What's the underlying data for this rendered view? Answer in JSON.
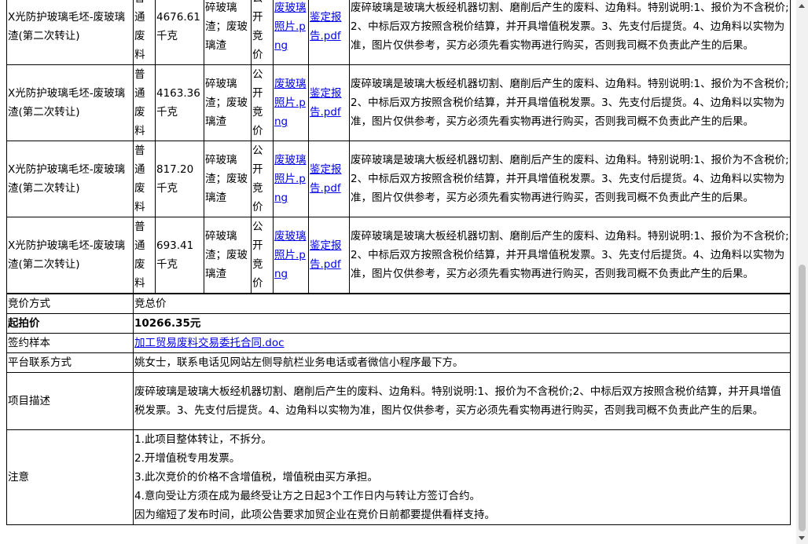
{
  "lots": [
    {
      "name": "X光防护玻璃毛坯-废玻璃渣(第二次转让)",
      "type": "普通废料",
      "weight": "4676.61千克",
      "category": "碎玻璃渣；废玻璃渣",
      "method": "公开竞价",
      "photo_link": "废玻璃照片.png",
      "report_link": "鉴定报告.pdf",
      "description": "废碎玻璃是玻璃大板经机器切割、磨削后产生的废料、边角料。特别说明:1、报价为不含税价;2、中标后双方按照含税价结算，并开具增值税发票。3、先支付后提货。4、边角料以实物为准，图片仅供参考，买方必须先看实物再进行购买，否则我司概不负责此产生的后果。"
    },
    {
      "name": "X光防护玻璃毛坯-废玻璃渣(第二次转让)",
      "type": "普通废料",
      "weight": "4163.36千克",
      "category": "碎玻璃渣；废玻璃渣",
      "method": "公开竞价",
      "photo_link": "废玻璃照片.png",
      "report_link": "鉴定报告.pdf",
      "description": "废碎玻璃是玻璃大板经机器切割、磨削后产生的废料、边角料。特别说明:1、报价为不含税价;2、中标后双方按照含税价结算，并开具增值税发票。3、先支付后提货。4、边角料以实物为准，图片仅供参考，买方必须先看实物再进行购买，否则我司概不负责此产生的后果。"
    },
    {
      "name": "X光防护玻璃毛坯-废玻璃渣(第二次转让)",
      "type": "普通废料",
      "weight": "817.20千克",
      "category": "碎玻璃渣；废玻璃渣",
      "method": "公开竞价",
      "photo_link": "废玻璃照片.png",
      "report_link": "鉴定报告.pdf",
      "description": "废碎玻璃是玻璃大板经机器切割、磨削后产生的废料、边角料。特别说明:1、报价为不含税价;2、中标后双方按照含税价结算，并开具增值税发票。3、先支付后提货。4、边角料以实物为准，图片仅供参考，买方必须先看实物再进行购买，否则我司概不负责此产生的后果。"
    },
    {
      "name": "X光防护玻璃毛坯-废玻璃渣(第二次转让)",
      "type": "普通废料",
      "weight": "693.41千克",
      "category": "碎玻璃渣；废玻璃渣",
      "method": "公开竞价",
      "photo_link": "废玻璃照片.png",
      "report_link": "鉴定报告.pdf",
      "description": "废碎玻璃是玻璃大板经机器切割、磨削后产生的废料、边角料。特别说明:1、报价为不含税价;2、中标后双方按照含税价结算，并开具增值税发票。3、先支付后提货。4、边角料以实物为准，图片仅供参考，买方必须先看实物再进行购买，否则我司概不负责此产生的后果。"
    }
  ],
  "info": {
    "bid_method_label": "竞价方式",
    "bid_method_value": "竞总价",
    "start_price_label": "起拍价",
    "start_price_value": "10266.35元",
    "contract_label": "签约样本",
    "contract_link": "加工贸易废料交易委托合同.doc",
    "contact_label": "平台联系方式",
    "contact_value": "姚女士，联系电话见网站左侧导航栏业务电话或者微信小程序最下方。",
    "project_desc_label": "项目描述",
    "project_desc_value": "废碎玻璃是玻璃大板经机器切割、磨削后产生的废料、边角料。特别说明:1、报价为不含税价;2、中标后双方按照含税价结算，并开具增值税发票。3、先支付后提货。4、边角料以实物为准，图片仅供参考，买方必须先看实物再进行购买，否则我司概不负责此产生的后果。",
    "notes_label": "注意",
    "notes": [
      "1.此项目整体转让，不拆分。",
      "2.开增值税专用发票。",
      "3.此次竞价的价格不含增值税，增值税由买方承担。",
      "4.意向受让方须在成为最终受让方之日起3个工作日内与转让方签订合约。",
      "因为缩短了发布时间，此项公告要求加贸企业在竞价日前都要提供看样支持。"
    ]
  },
  "scrollbar": {
    "position_fraction": 0.49
  }
}
